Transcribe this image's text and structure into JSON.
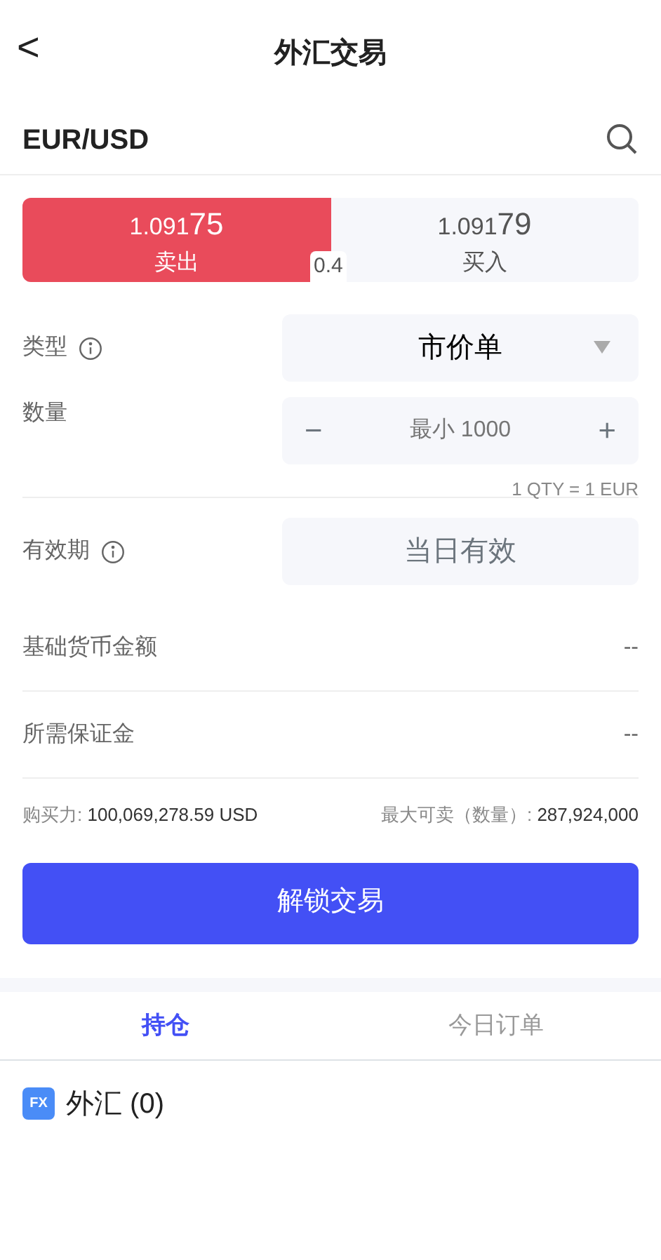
{
  "header": {
    "back": "<",
    "title": "外汇交易"
  },
  "symbol": "EUR/USD",
  "quote": {
    "sides": [
      {
        "kind": "sell",
        "price_main": "1.091",
        "price_pips": "75",
        "label": "卖出",
        "selected": true
      },
      {
        "kind": "buy",
        "price_main": "1.091",
        "price_pips": "79",
        "label": "买入",
        "selected": false
      }
    ],
    "spread": "0.4"
  },
  "form": [
    {
      "kind": "select",
      "label": "类型",
      "info": true,
      "value": "市价单"
    },
    {
      "kind": "stepper",
      "label": "数量",
      "info": false,
      "placeholder": "最小 1000",
      "minus": "−",
      "plus": "+",
      "note": "1 QTY = 1 EUR"
    },
    {
      "kind": "static",
      "label": "有效期",
      "info": true,
      "value": "当日有效"
    },
    {
      "kind": "text",
      "label": "基础货币金额",
      "value": "--"
    },
    {
      "kind": "text",
      "label": "所需保证金",
      "value": "--"
    }
  ],
  "summary": [
    {
      "label": "购买力:",
      "value": "100,069,278.59 USD"
    },
    {
      "label": "最大可卖（数量）:",
      "value": "287,924,000"
    }
  ],
  "unlock_button": "解锁交易",
  "tabs": [
    {
      "label": "持仓",
      "selected": true
    },
    {
      "label": "今日订单",
      "selected": false
    }
  ],
  "positions": [
    {
      "badge": "FX",
      "label": "外汇 (0)"
    }
  ]
}
